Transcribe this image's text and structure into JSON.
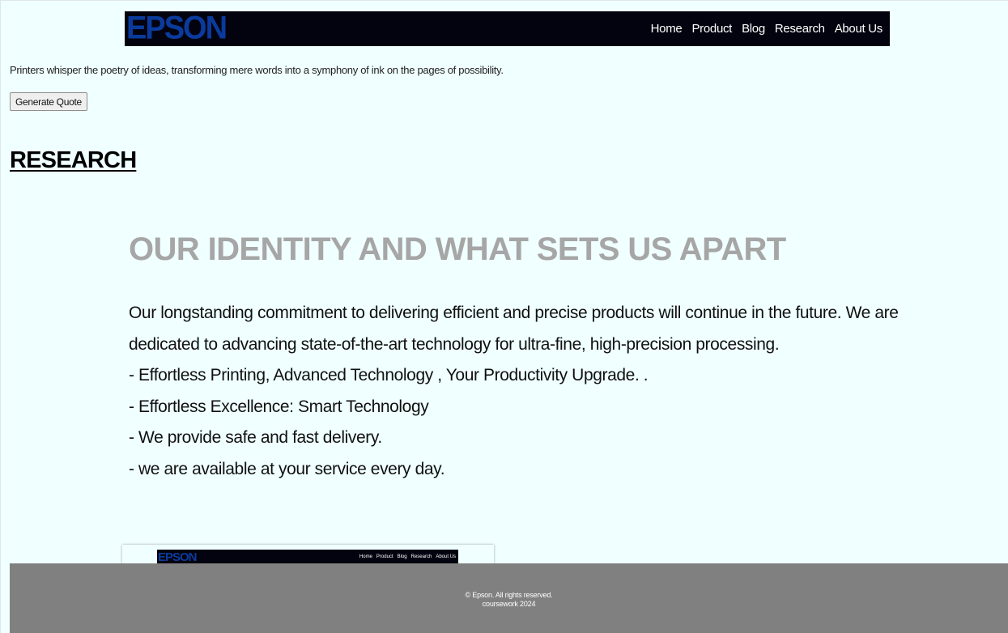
{
  "header": {
    "logo": "EPSON",
    "nav": [
      "Home",
      "Product",
      "Blog",
      "Research",
      "About Us"
    ]
  },
  "tagline": "Printers whisper the poetry of ideas, transforming mere words into a symphony of ink on the pages of possibility.",
  "quote_button": "Generate Quote",
  "section_title": "RESEARCH",
  "identity": {
    "heading": "OUR IDENTITY AND WHAT SETS US APART",
    "lines": [
      "Our longstanding commitment to delivering efficient and precise products will continue in the future. We are",
      "dedicated to advancing state-of-the-art technology for ultra-fine, high-precision processing.",
      "- Effortless Printing, Advanced Technology , Your Productivity Upgrade. .",
      "- Effortless Excellence: Smart Technology",
      "- We provide safe and fast delivery.",
      "- we are available at your service every day."
    ]
  },
  "thumbnail": {
    "logo": "EPSON",
    "nav": [
      "Home",
      "Product",
      "Blog",
      "Research",
      "About Us"
    ]
  },
  "footer": {
    "line1": "© Epson. All rights reserved.",
    "line2": "coursework 2024"
  },
  "colors": {
    "page_background": "#f0ffff",
    "navbar_background": "#03020f",
    "logo_blue": "#0a3b9c",
    "heading_gray": "#a6a6a6",
    "footer_gray": "#808080"
  }
}
